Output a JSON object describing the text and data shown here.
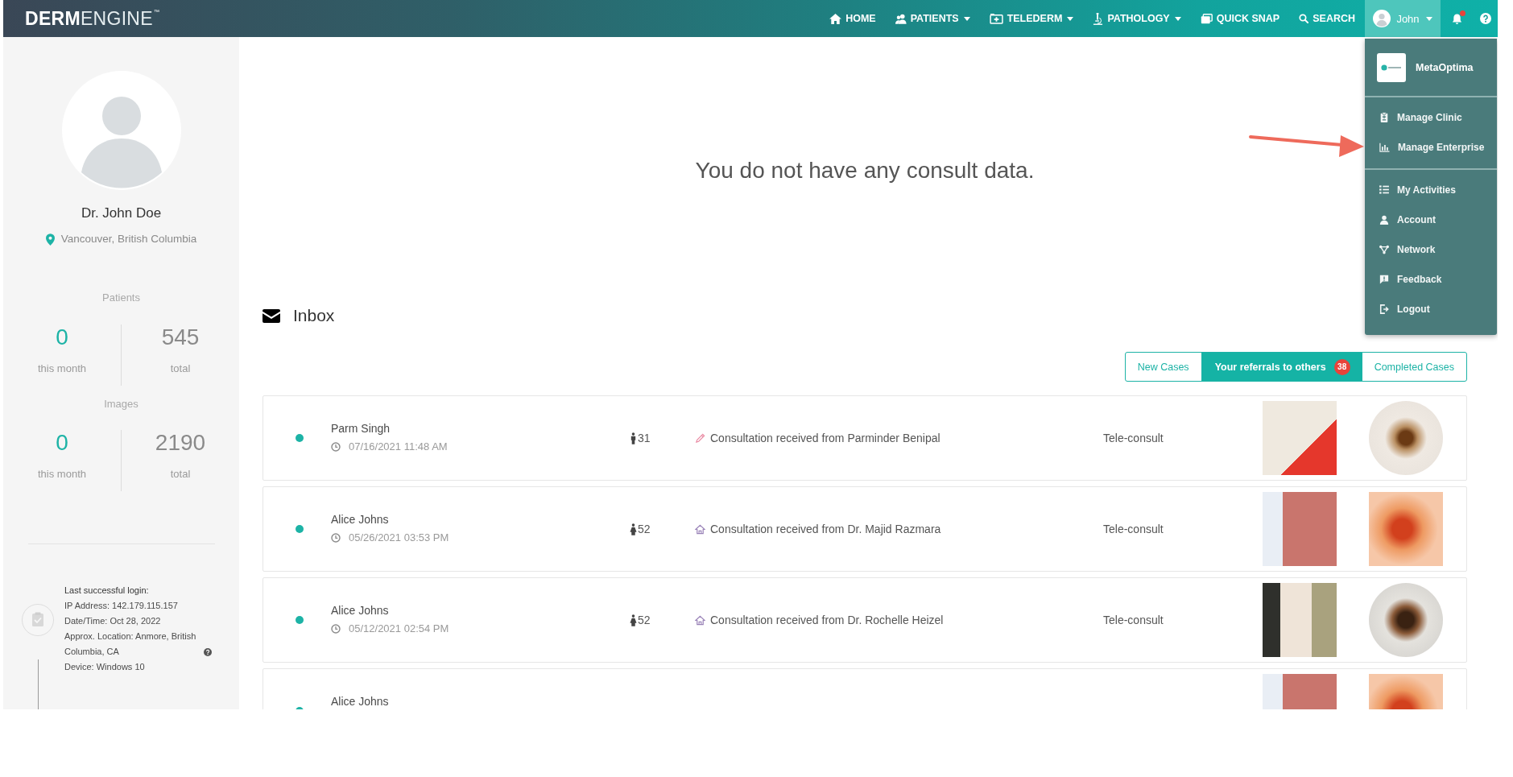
{
  "nav": {
    "logo": {
      "strong": "DERM",
      "light": "ENGINE",
      "mark": "™"
    },
    "items": [
      {
        "label": "HOME",
        "dropdown": false
      },
      {
        "label": "PATIENTS",
        "dropdown": true
      },
      {
        "label": "TELEDERM",
        "dropdown": true
      },
      {
        "label": "PATHOLOGY",
        "dropdown": true
      },
      {
        "label": "QUICK SNAP",
        "dropdown": false
      },
      {
        "label": "SEARCH",
        "dropdown": false
      }
    ],
    "user": {
      "name": "John",
      "expanded": true
    },
    "notifications": {
      "unread": true
    }
  },
  "user_menu": {
    "organization": "MetaOptima",
    "groups": [
      {
        "items": [
          "Manage Clinic",
          "Manage Enterprise"
        ]
      },
      {
        "items": [
          "My Activities",
          "Account",
          "Network",
          "Feedback",
          "Logout"
        ]
      }
    ]
  },
  "callouts": [
    {
      "kind": "arrow"
    }
  ],
  "sidebar": {
    "name": "Dr. John Doe",
    "location": "Vancouver, British Columbia",
    "stats": [
      {
        "label": "Patients",
        "month_value": "0",
        "month_label": "this month",
        "total_value": "545",
        "total_label": "total"
      },
      {
        "label": "Images",
        "month_value": "0",
        "month_label": "this month",
        "total_value": "2190",
        "total_label": "total"
      }
    ],
    "last_login": {
      "title": "Last successful login:",
      "ip": "IP Address: 142.179.115.157",
      "datetime": "Date/Time: Oct 28, 2022",
      "location": "Approx. Location: Anmore, British Columbia, CA",
      "device": "Device: Windows 10"
    }
  },
  "main": {
    "empty_message": "You do not have any consult data.",
    "inbox": {
      "title": "Inbox",
      "tabs": [
        {
          "label": "New Cases",
          "selected": false
        },
        {
          "label": "Your referrals to others",
          "selected": true,
          "badge": "38"
        },
        {
          "label": "Completed Cases",
          "selected": false
        }
      ],
      "rows": [
        {
          "color": "#1db3a6",
          "name": "Parm Singh",
          "date": "07/16/2021 11:48 AM",
          "age": {
            "kind": "male",
            "value": "31"
          },
          "message": {
            "kind": "edit",
            "text": "Consultation received from Parminder Benipal"
          },
          "type": "Tele-consult",
          "images": [
            {
              "kind": "square"
            },
            {
              "kind": "round"
            }
          ]
        },
        {
          "color": "#1db3a6",
          "name": "Alice Johns",
          "date": "05/26/2021 03:53 PM",
          "age": {
            "kind": "female",
            "value": "52"
          },
          "message": {
            "kind": "home",
            "text": "Consultation received from Dr. Majid Razmara"
          },
          "type": "Tele-consult",
          "images": [
            {
              "kind": "square"
            },
            {
              "kind": "square"
            }
          ]
        },
        {
          "color": "#1db3a6",
          "name": "Alice Johns",
          "date": "05/12/2021 02:54 PM",
          "age": {
            "kind": "female",
            "value": "52"
          },
          "message": {
            "kind": "home",
            "text": "Consultation received from Dr. Rochelle Heizel"
          },
          "type": "Tele-consult",
          "images": [
            {
              "kind": "square"
            },
            {
              "kind": "round"
            }
          ]
        },
        {
          "color": "#1db3a6",
          "name": "Alice Johns",
          "images": [
            {
              "kind": "square"
            },
            {
              "kind": "square"
            }
          ]
        }
      ]
    }
  }
}
